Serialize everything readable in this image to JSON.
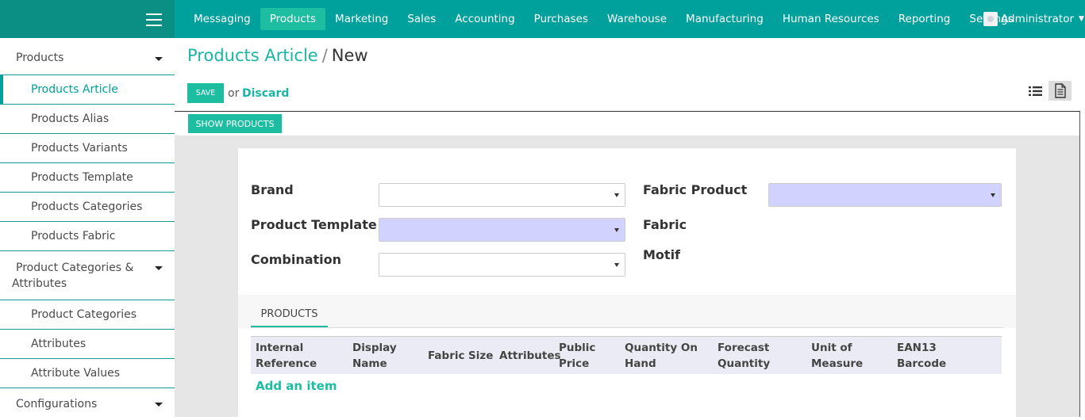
{
  "app": {
    "menu": [
      "Messaging",
      "Products",
      "Marketing",
      "Sales",
      "Accounting",
      "Purchases",
      "Warehouse",
      "Manufacturing",
      "Human Resources",
      "Reporting",
      "Settings"
    ],
    "active_menu": "Products",
    "user_name": "Administrator",
    "accent_color": "#00a09d",
    "button_color": "#1dbda2"
  },
  "sidebar": {
    "section1": "Products",
    "items1": [
      "Products Article",
      "Products Alias",
      "Products Variants",
      "Products Template",
      "Products Categories",
      "Products Fabric"
    ],
    "section2_line1": "Product Categories &",
    "section2_line2": "Attributes",
    "items2": [
      "Product Categories",
      "Attributes",
      "Attribute Values"
    ],
    "section3": "Configurations"
  },
  "breadcrumb": {
    "parent": "Products Article",
    "separator": "/",
    "current": "New"
  },
  "buttons": {
    "save": "SAVE",
    "or": "or",
    "discard": "Discard",
    "show_products": "SHOW PRODUCTS"
  },
  "form": {
    "brand_label": "Brand",
    "product_template_label": "Product Template",
    "combination_label": "Combination",
    "fabric_product_label": "Fabric Product",
    "fabric_label": "Fabric",
    "motif_label": "Motif",
    "brand_value": "",
    "product_template_value": "",
    "combination_value": "",
    "fabric_product_value": ""
  },
  "notebook": {
    "tab": "PRODUCTS",
    "columns": [
      [
        "Internal",
        "Reference"
      ],
      [
        "Display",
        "Name"
      ],
      [
        "Fabric"
      ],
      [
        "Size"
      ],
      [
        "Attributes"
      ],
      [
        "Public",
        "Price"
      ],
      [
        "Quantity On",
        "Hand"
      ],
      [
        "Forecast",
        "Quantity"
      ],
      [
        "Unit of",
        "Measure"
      ],
      [
        "EAN13",
        "Barcode"
      ]
    ],
    "add_item": "Add an item"
  }
}
